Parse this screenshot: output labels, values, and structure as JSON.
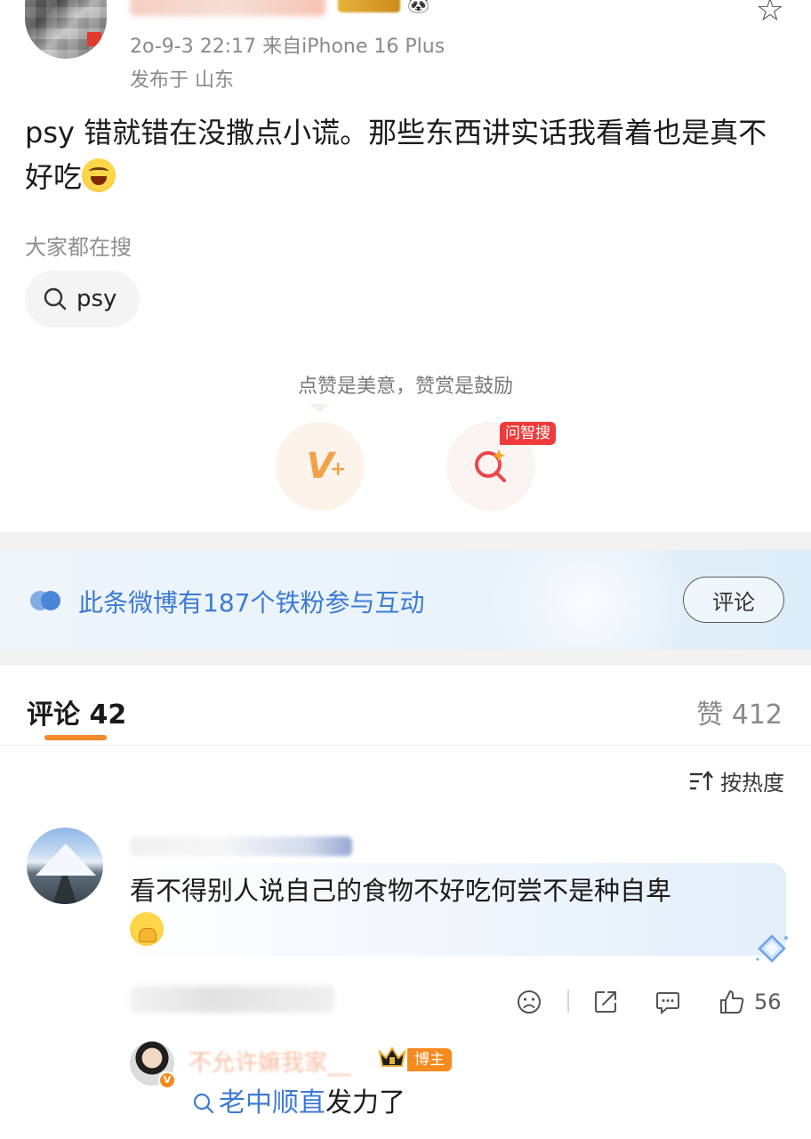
{
  "post": {
    "time": "2o-9-3 22:17",
    "source": "来自iPhone 16 Plus",
    "location": "发布于 山东",
    "text": "psy 错就错在没撒点小谎。那些东西讲实话我看着也是真不好吃"
  },
  "search": {
    "hint": "大家都在搜",
    "chip": "psy"
  },
  "reward": {
    "caption": "点赞是美意，赞赏是鼓励",
    "ai_badge": "问智搜"
  },
  "fans_banner": {
    "text": "此条微博有187个铁粉参与互动",
    "button": "评论"
  },
  "tabs": {
    "comments": "评论 42",
    "likes": "赞 412"
  },
  "sort": {
    "label": "按热度"
  },
  "comments": [
    {
      "text": "看不得别人说自己的食物不好吃何尝不是种自卑",
      "likes": "56"
    }
  ],
  "reply": {
    "name": "不允许嫲我家__",
    "badge": "博主",
    "link_text": "老中顺直",
    "text_rest": "发力了"
  },
  "colors": {
    "accent": "#f28a2e",
    "link": "#3d7bd4",
    "badge_red": "#ef3b3b"
  },
  "icons": [
    "star-icon",
    "search-icon",
    "reward-icon",
    "ai-search-icon",
    "fans-icon",
    "sort-icon",
    "dislike-icon",
    "share-icon",
    "comment-icon",
    "like-icon",
    "diamond-icon",
    "crown-icon"
  ]
}
